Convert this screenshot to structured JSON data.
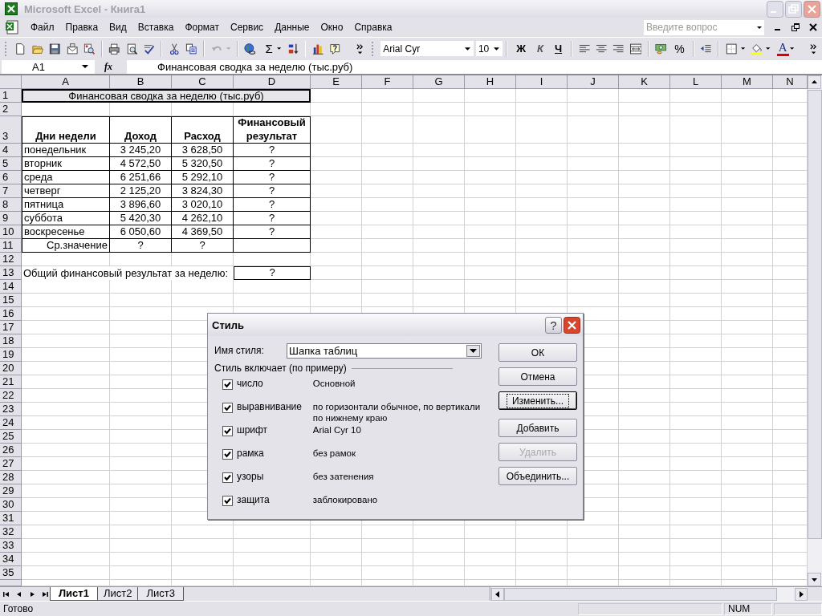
{
  "window": {
    "title": "Microsoft Excel - Книга1"
  },
  "menu": [
    "Файл",
    "Правка",
    "Вид",
    "Вставка",
    "Формат",
    "Сервис",
    "Данные",
    "Окно",
    "Справка"
  ],
  "help_box": {
    "placeholder": "Введите вопрос"
  },
  "standard_toolbar": {
    "autosum": "Σ",
    "undo_disabled": true
  },
  "formatting_toolbar": {
    "font": "Arial Cyr",
    "size": "10",
    "bold": "Ж",
    "italic": "К",
    "underline": "Ч",
    "percent": "%",
    "font_color": "A"
  },
  "formula_bar": {
    "name_box": "A1",
    "function_label": "fx",
    "content": "Финансовая сводка за неделю (тыс.руб)"
  },
  "sheet": {
    "columns": [
      "A",
      "B",
      "C",
      "D",
      "E",
      "F",
      "G",
      "H",
      "I",
      "J",
      "K",
      "L",
      "M",
      "N"
    ],
    "row_headers": [
      "1",
      "2",
      "3",
      "4",
      "5",
      "6",
      "7",
      "8",
      "9",
      "10",
      "11",
      "12",
      "13",
      "14",
      "15",
      "16",
      "17",
      "18",
      "19",
      "20",
      "21",
      "22",
      "23",
      "24",
      "25",
      "26",
      "27",
      "28",
      "29",
      "30",
      "31",
      "32",
      "33",
      "34",
      "35"
    ],
    "title_cell": "Финансовая сводка за неделю (тыс.руб)",
    "table": {
      "headers": [
        "Дни недели",
        "Доход",
        "Расход",
        "Финансовый результат"
      ],
      "rows": [
        {
          "day": "понедельник",
          "income": "3 245,20",
          "expense": "3 628,50",
          "result": "?"
        },
        {
          "day": "вторник",
          "income": "4 572,50",
          "expense": "5 320,50",
          "result": "?"
        },
        {
          "day": "среда",
          "income": "6 251,66",
          "expense": "5 292,10",
          "result": "?"
        },
        {
          "day": "четверг",
          "income": "2 125,20",
          "expense": "3 824,30",
          "result": "?"
        },
        {
          "day": "пятница",
          "income": "3 896,60",
          "expense": "3 020,10",
          "result": "?"
        },
        {
          "day": "суббота",
          "income": "5 420,30",
          "expense": "4 262,10",
          "result": "?"
        },
        {
          "day": "воскресенье",
          "income": "6 050,60",
          "expense": "4 369,50",
          "result": "?"
        }
      ],
      "average": {
        "label": "Ср.значение",
        "income": "?",
        "expense": "?"
      }
    },
    "total": {
      "label": "Общий финансовый результат за неделю:",
      "value": "?"
    }
  },
  "dialog": {
    "title": "Стиль",
    "help": "?",
    "style_name_label": "Имя стиля:",
    "style_name": "Шапка таблиц",
    "group_label": "Стиль включает (по примеру)",
    "options": [
      {
        "label": "число",
        "value": "Основной",
        "checked": true
      },
      {
        "label": "выравнивание",
        "value": "по горизонтали обычное, по вертикали по нижнему краю",
        "checked": true
      },
      {
        "label": "шрифт",
        "value": "Arial Cyr 10",
        "checked": true
      },
      {
        "label": "рамка",
        "value": "без рамок",
        "checked": true
      },
      {
        "label": "узоры",
        "value": "без затенения",
        "checked": true
      },
      {
        "label": "защита",
        "value": "заблокировано",
        "checked": true
      }
    ],
    "button_groups": [
      [
        {
          "label": "ОК",
          "disabled": false,
          "focused": false
        },
        {
          "label": "Отмена",
          "disabled": false,
          "focused": false
        },
        {
          "label": "Изменить...",
          "disabled": false,
          "focused": true
        }
      ],
      [
        {
          "label": "Добавить",
          "disabled": false,
          "focused": false
        },
        {
          "label": "Удалить",
          "disabled": true,
          "focused": false
        },
        {
          "label": "Объединить...",
          "disabled": false,
          "focused": false
        }
      ]
    ]
  },
  "sheet_tabs": [
    {
      "label": "Лист1",
      "selected": true
    },
    {
      "label": "Лист2",
      "selected": false
    },
    {
      "label": "Лист3",
      "selected": false
    }
  ],
  "status_bar": {
    "message": "Готово",
    "indicator": "NUM"
  }
}
